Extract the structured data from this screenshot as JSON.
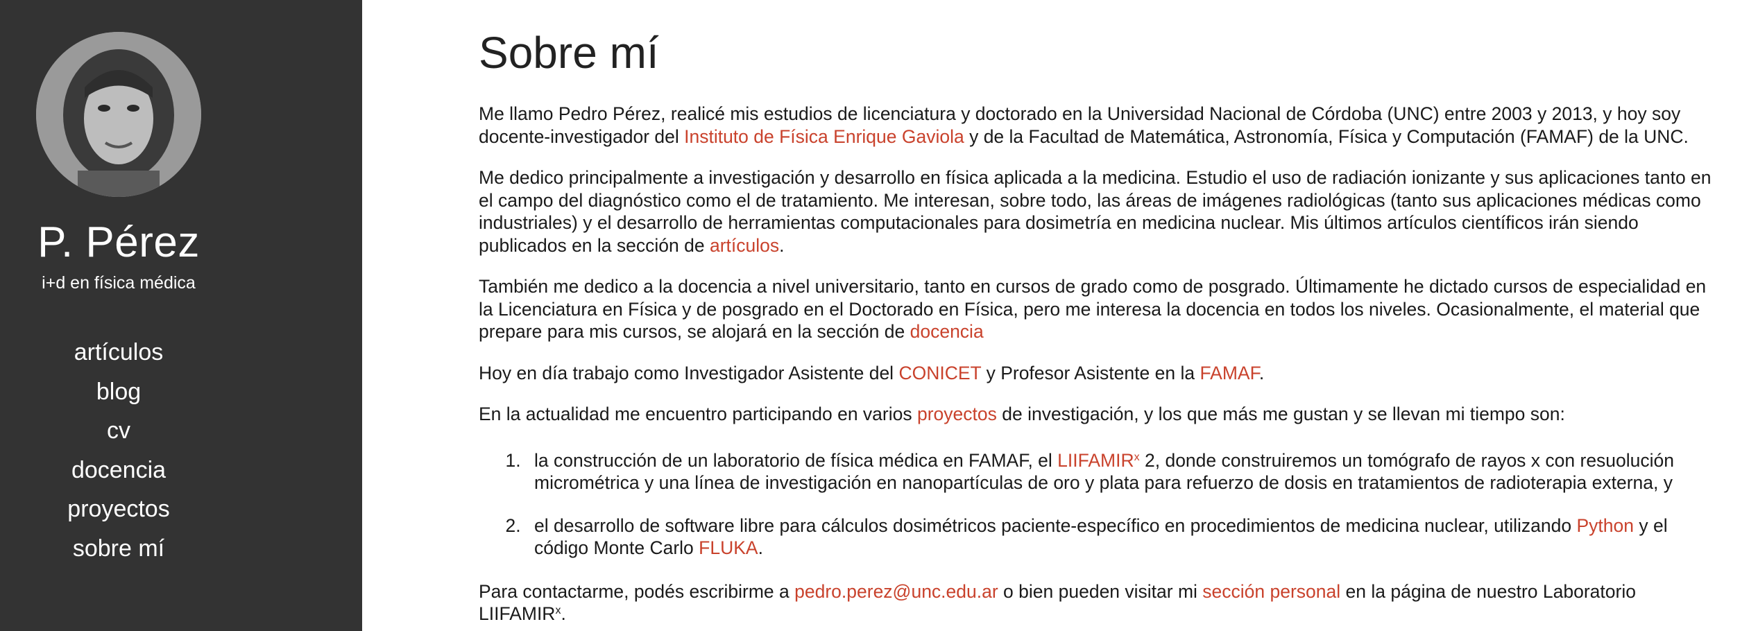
{
  "sidebar": {
    "name": "P. Pérez",
    "tagline": "i+d en física médica",
    "nav": [
      {
        "label": "artículos"
      },
      {
        "label": "blog"
      },
      {
        "label": "cv"
      },
      {
        "label": "docencia"
      },
      {
        "label": "proyectos"
      },
      {
        "label": "sobre mí"
      }
    ]
  },
  "main": {
    "title": "Sobre mí",
    "p1": {
      "t1": "Me llamo Pedro Pérez, realicé mis estudios de licenciatura y doctorado en la Universidad Nacional de Córdoba (UNC) entre 2003 y 2013, y hoy soy docente-investigador del ",
      "link1": "Instituto de Física Enrique Gaviola",
      "t2": " y de la Facultad de Matemática, Astronomía, Física y Computación (FAMAF) de la UNC."
    },
    "p2": {
      "t1": "Me dedico principalmente a investigación y desarrollo en física aplicada a la medicina. Estudio el uso de radiación ionizante y sus aplicaciones tanto en el campo del diagnóstico como el de tratamiento. Me interesan, sobre todo, las áreas de imágenes radiológicas (tanto sus aplicaciones médicas como industriales) y el desarrollo de herramientas computacionales para dosimetría en medicina nuclear. Mis últimos artículos científicos irán siendo publicados en la sección de ",
      "link1": "artículos",
      "t2": "."
    },
    "p3": {
      "t1": "También me dedico a la docencia a nivel universitario, tanto en cursos de grado como de posgrado. Últimamente he dictado cursos de especialidad en la Licenciatura en Física y de posgrado en el Doctorado en Física, pero me interesa la docencia en todos los niveles. Ocasionalmente, el material que prepare para mis cursos, se alojará en la sección de ",
      "link1": "docencia"
    },
    "p4": {
      "t1": "Hoy en día trabajo como Investigador Asistente del ",
      "link1": "CONICET",
      "t2": " y Profesor Asistente en la ",
      "link2": "FAMAF",
      "t3": "."
    },
    "p5": {
      "t1": "En la actualidad me encuentro participando en varios ",
      "link1": "proyectos",
      "t2": " de investigación, y los que más me gustan y se llevan mi tiempo son:"
    },
    "list": [
      {
        "t1": "la construcción de un laboratorio de física médica en FAMAF, el ",
        "link1": "LIIFAMIR",
        "sup1": "x",
        "t2": " 2, donde construiremos un tomógrafo de rayos x con resuolución micrométrica y una línea de investigación en nanopartículas de oro y plata para refuerzo de dosis en tratamientos de radioterapia externa, y"
      },
      {
        "t1": "el desarrollo de software libre para cálculos dosimétricos paciente-específico en procedimientos de medicina nuclear, utilizando ",
        "link1": "Python",
        "t2": " y el código Monte Carlo ",
        "link2": "FLUKA",
        "t3": "."
      }
    ],
    "p6": {
      "t1": "Para contactarme, podés escribirme a ",
      "link1": "pedro.perez@unc.edu.ar",
      "t2": " o bien pueden visitar mi ",
      "link2": "sección personal",
      "t3": " en la página de nuestro Laboratorio LIIFAMIR",
      "sup1": "x",
      "t4": "."
    }
  },
  "colors": {
    "sidebar_bg": "#333333",
    "link": "#c9422c",
    "text": "#1a1a1a"
  }
}
